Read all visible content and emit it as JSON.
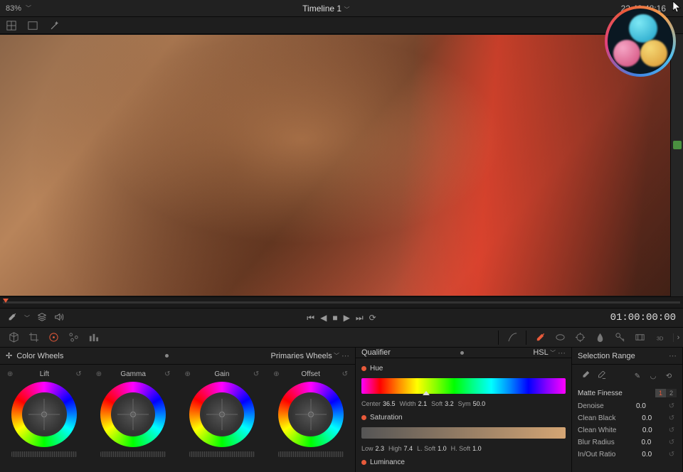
{
  "topbar": {
    "zoom": "83%",
    "title": "Timeline 1",
    "timecode": "22:43:48:16"
  },
  "transport": {
    "timecode": "01:00:00:00"
  },
  "colorWheels": {
    "title": "Color Wheels",
    "mode": "Primaries Wheels",
    "wheels": [
      {
        "name": "Lift"
      },
      {
        "name": "Gamma"
      },
      {
        "name": "Gain"
      },
      {
        "name": "Offset"
      }
    ]
  },
  "qualifier": {
    "title": "Qualifier",
    "mode": "HSL",
    "hue": {
      "label": "Hue",
      "center_l": "Center",
      "center_v": "36.5",
      "width_l": "Width",
      "width_v": "2.1",
      "soft_l": "Soft",
      "soft_v": "3.2",
      "sym_l": "Sym",
      "sym_v": "50.0"
    },
    "sat": {
      "label": "Saturation",
      "low_l": "Low",
      "low_v": "2.3",
      "high_l": "High",
      "high_v": "7.4",
      "lsoft_l": "L. Soft",
      "lsoft_v": "1.0",
      "hsoft_l": "H. Soft",
      "hsoft_v": "1.0"
    },
    "lum": {
      "label": "Luminance"
    }
  },
  "selection": {
    "title": "Selection Range",
    "matte": {
      "title": "Matte Finesse",
      "tab1": "1",
      "tab2": "2",
      "rows": [
        {
          "label": "Denoise",
          "value": "0.0"
        },
        {
          "label": "Clean Black",
          "value": "0.0"
        },
        {
          "label": "Clean White",
          "value": "0.0"
        },
        {
          "label": "Blur Radius",
          "value": "0.0"
        },
        {
          "label": "In/Out Ratio",
          "value": "0.0"
        }
      ]
    }
  }
}
